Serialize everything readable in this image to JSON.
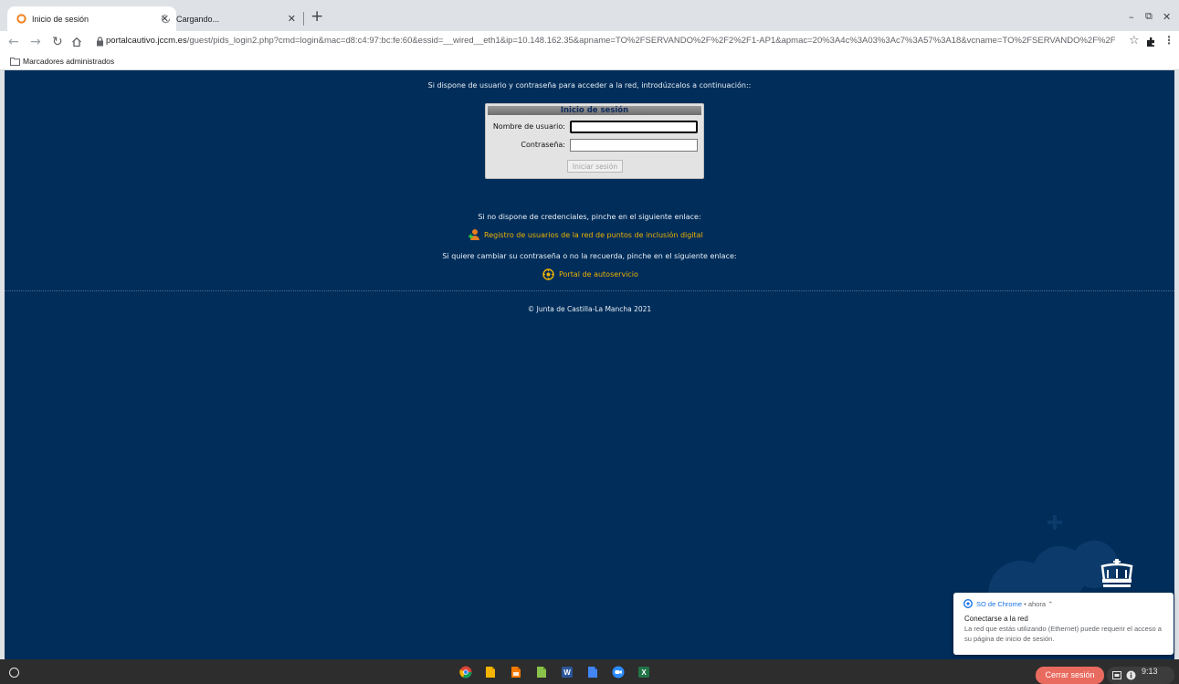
{
  "browser": {
    "tabs": [
      {
        "title": "Inicio de sesión",
        "favicon": "orange-circle-icon",
        "active": true
      },
      {
        "title": "Cargando...",
        "favicon": "loading-spinner-icon",
        "active": false
      }
    ],
    "new_tab_label": "+",
    "url_host": "portalcautivo.jccm.es",
    "url_path": "/guest/pids_login2.php?cmd=login&mac=d8:c4:97:bc:fe:60&essid=__wired__eth1&ip=10.148.162.35&apname=TO%2FSERVANDO%2F%2F2%2F1-AP1&apmac=20%3A4c%3A03%3Ac7%3A57%3A18&vcname=TO%2FSERVANDO%2F%2F2%2F...",
    "bookmarks_folder": "Marcadores administrados"
  },
  "page": {
    "intro": "Si dispone de usuario y contraseña para acceder a la red, introdúzcalos a continuación::",
    "login": {
      "title": "Inicio de sesión",
      "username_label": "Nombre de usuario:",
      "password_label": "Contraseña:",
      "submit_label": "Iniciar sesión",
      "username_value": "",
      "password_value": ""
    },
    "no_credentials": "Si no dispone de credenciales, pinche en el siguiente enlace:",
    "register_link": "Registro de usuarios de la red de puntos de inclusión digital",
    "change_password": "Si quiere cambiar su contraseña o no la recuerda, pinche en el siguiente enlace:",
    "selfservice_link": "Portal de autoservicio",
    "footer": "© Junta de Castilla-La Mancha 2021"
  },
  "notification": {
    "source": "SO de Chrome",
    "time": "• ahora ⌃",
    "title": "Conectarse a la red",
    "body": "La red que estás utilizando (Ethernet) puede requerir el acceso a su página de inicio de sesión."
  },
  "shelf": {
    "sign_out_label": "Cerrar sesión",
    "clock": "9:13"
  },
  "colors": {
    "page_bg": "#002d5a",
    "link": "#f0b200",
    "sign_out": "#e96b5f"
  }
}
